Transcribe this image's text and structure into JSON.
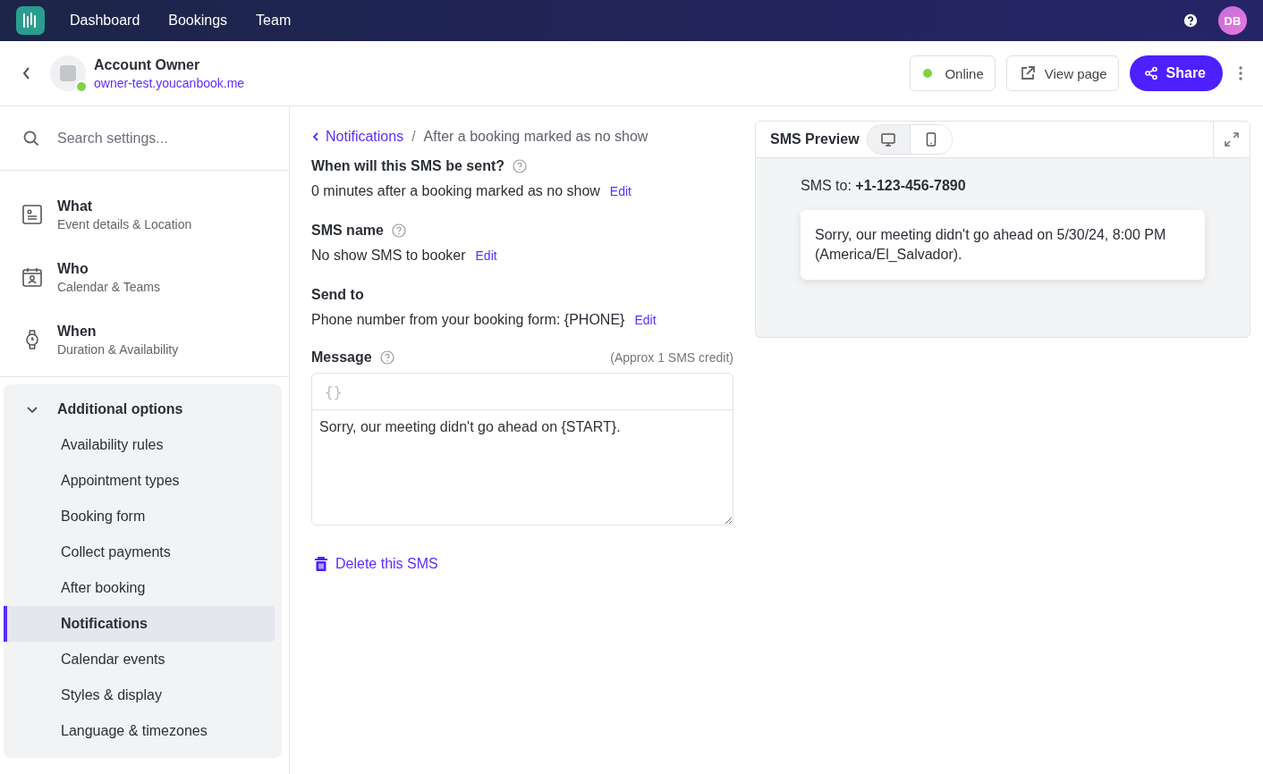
{
  "nav": {
    "items": [
      "Dashboard",
      "Bookings",
      "Team"
    ],
    "avatar": "DB"
  },
  "header": {
    "title": "Account Owner",
    "url": "owner-test.youcanbook.me",
    "status": {
      "label": "Online",
      "online": true
    },
    "view_page": "View page",
    "share": "Share"
  },
  "sidebar": {
    "search": {
      "placeholder": "Search settings..."
    },
    "sections": [
      {
        "kind": "what",
        "title": "What",
        "subtitle": "Event details & Location"
      },
      {
        "kind": "who",
        "title": "Who",
        "subtitle": "Calendar & Teams"
      },
      {
        "kind": "when",
        "title": "When",
        "subtitle": "Duration & Availability"
      }
    ],
    "group": {
      "title": "Additional options",
      "expanded": true,
      "items": [
        {
          "label": "Availability rules",
          "selected": false
        },
        {
          "label": "Appointment types",
          "selected": false
        },
        {
          "label": "Booking form",
          "selected": false
        },
        {
          "label": "Collect payments",
          "selected": false
        },
        {
          "label": "After booking",
          "selected": false
        },
        {
          "label": "Notifications",
          "selected": true
        },
        {
          "label": "Calendar events",
          "selected": false
        },
        {
          "label": "Styles & display",
          "selected": false
        },
        {
          "label": "Language & timezones",
          "selected": false
        }
      ]
    }
  },
  "breadcrumb": {
    "parent": "Notifications",
    "separator": "/",
    "current": "After a booking marked as no show"
  },
  "fields": [
    {
      "label": "When will this SMS be sent?",
      "help": true,
      "value": "0 minutes after a booking marked as no show",
      "action": "Edit"
    },
    {
      "label": "SMS name",
      "help": true,
      "value": "No show SMS to booker",
      "action": "Edit"
    },
    {
      "label": "Send to",
      "help": false,
      "value": "Phone number from your booking form: {PHONE}",
      "action": "Edit"
    }
  ],
  "message": {
    "label": "Message",
    "help": true,
    "credit": "(Approx 1 SMS credit)",
    "toolbar_icon": "{}",
    "value": "Sorry, our meeting didn't go ahead on {START}."
  },
  "delete": "Delete this SMS",
  "preview": {
    "title": "SMS Preview",
    "views": [
      {
        "kind": "desktop",
        "selected": true
      },
      {
        "kind": "mobile",
        "selected": false
      }
    ],
    "to": "SMS to: **+1-123-456-7890**",
    "text": "Sorry, our meeting didn't go ahead on 5/30/24, 8:00 PM (America/El_Salvador)."
  }
}
